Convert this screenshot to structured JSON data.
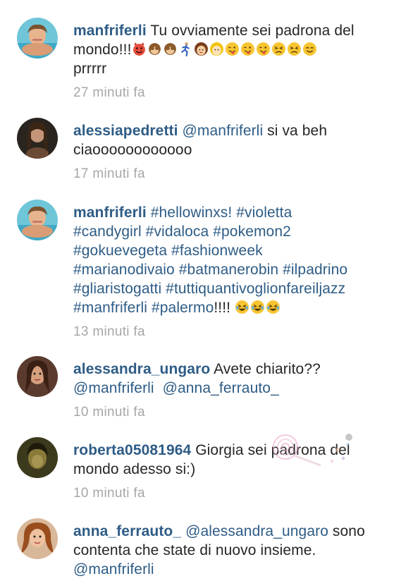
{
  "comments": [
    {
      "username": "manfriferli",
      "text": "Tu ovviamente sei padrona del mondo!!!",
      "text_after": "prrrrr",
      "emojis": [
        "smiling-devil-icon",
        "see-no-evil-monkey-icon",
        "see-no-evil-monkey-icon",
        "running-person-icon",
        "girl-face-icon",
        "person-blonde-icon",
        "tongue-wink-face-icon",
        "tongue-wink-face-icon",
        "tongue-wink-face-icon",
        "persevering-face-icon",
        "persevering-face-icon",
        "relieved-face-icon"
      ],
      "time": "27 minuti fa"
    },
    {
      "username": "alessiapedretti",
      "mention": "@manfriferli",
      "text": "si va beh ciaoooooooooooo",
      "time": "17 minuti fa"
    },
    {
      "username": "manfriferli",
      "hashtags": [
        "#hellowinxs!",
        "#violetta",
        "#candygirl",
        "#vidaloca",
        "#pokemon2",
        "#gokuevegeta",
        "#fashionweek",
        "#marianodivaio",
        "#batmanerobin",
        "#ilpadrino",
        "#gliaristogatti",
        "#tuttiquantivoglionfareiljazz",
        "#manfriferli",
        "#palermo"
      ],
      "text_after": "!!!!",
      "emojis": [
        "laughing-tears-face-icon",
        "laughing-tears-face-icon",
        "laughing-tears-face-icon"
      ],
      "time": "13 minuti fa"
    },
    {
      "username": "alessandra_ungaro",
      "text": "Avete chiarito??",
      "mentions": [
        "@manfriferli",
        "@anna_ferrauto_"
      ],
      "time": "10 minuti fa"
    },
    {
      "username": "roberta05081964",
      "text": "Giorgia sei padrona del mondo adesso si:)",
      "time": "10 minuti fa"
    },
    {
      "username": "anna_ferrauto_",
      "mention": "@alessandra_ungaro",
      "text": "sono contenta che state di nuovo insieme.",
      "mention_after": "@manfriferli"
    }
  ],
  "colors": {
    "username": "#2e5c86",
    "text": "#262626",
    "time": "#a7a7a7",
    "background": "#ffffff"
  }
}
